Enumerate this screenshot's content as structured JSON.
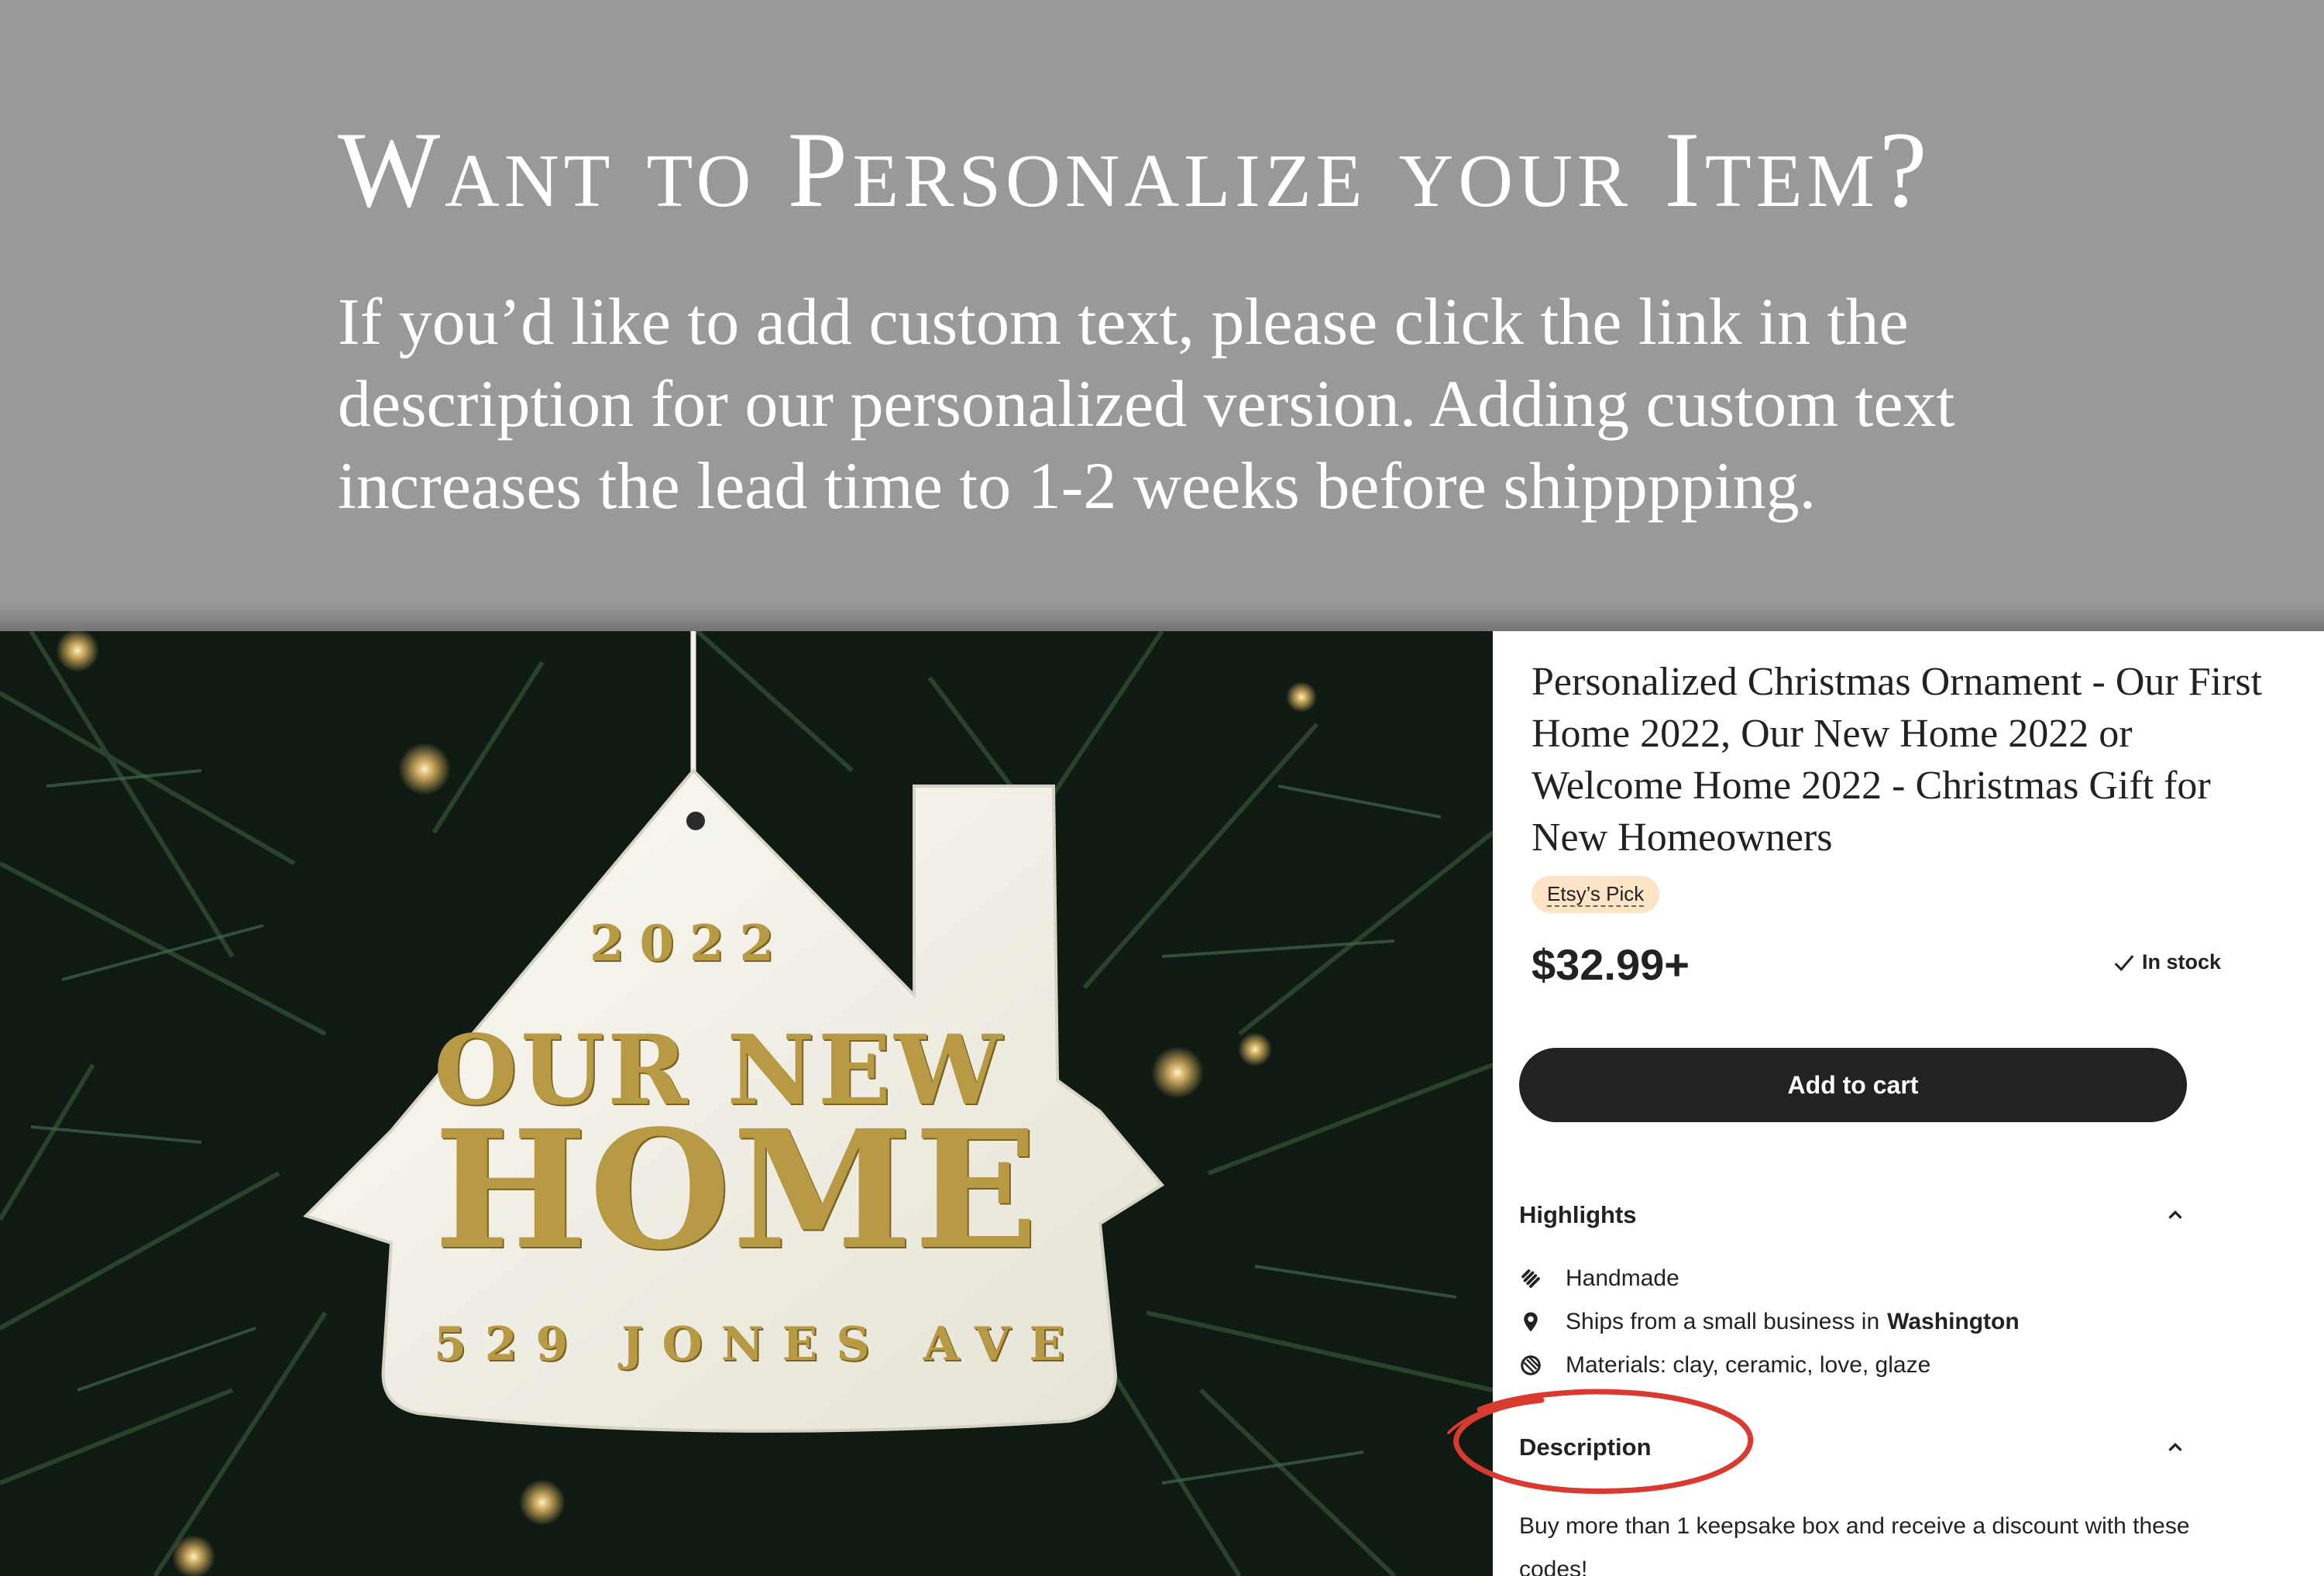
{
  "banner": {
    "title": "Want to Personalize your Item?",
    "body": "If you’d like to add custom text, please click the link in the description for our personalized version. Adding custom text increases the lead time to 1-2 weeks before shipppping."
  },
  "ornament": {
    "year": "2022",
    "line1": "OUR NEW",
    "line2": "HOME",
    "address": "529 JONES AVE"
  },
  "listing": {
    "title": "Personalized Christmas Ornament - Our First Home 2022, Our New Home 2022 or Welcome Home 2022 - Christmas Gift for New Homeowners",
    "badge": "Etsy’s Pick",
    "price": "$32.99+",
    "stock": "In stock",
    "add_to_cart": "Add to cart",
    "highlights": {
      "label": "Highlights",
      "items": [
        {
          "icon": "hand-icon",
          "text": "Handmade",
          "bold": ""
        },
        {
          "icon": "location-pin-icon",
          "text": "Ships from a small business in",
          "bold": "Washington"
        },
        {
          "icon": "materials-icon",
          "text": "Materials: clay, ceramic, love, glaze",
          "bold": ""
        }
      ]
    },
    "description": {
      "label": "Description",
      "text": "Buy more than 1 keepsake box and receive a discount with these codes!"
    }
  },
  "colors": {
    "banner_bg": "#999999",
    "button_bg": "#222222",
    "badge_bg": "#fde4c6",
    "annotation": "#d83a30",
    "gold": "#b89a45"
  }
}
